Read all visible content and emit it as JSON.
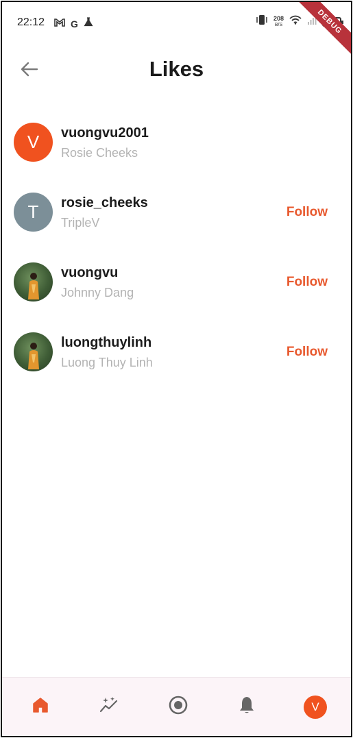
{
  "status_bar": {
    "time": "22:12",
    "left_icons": [
      "gmail-icon",
      "google-icon",
      "flask-icon"
    ],
    "data_rate": "208",
    "data_rate_unit": "B/S",
    "right_icons": [
      "vibrate-icon",
      "wifi-icon",
      "signal-icon",
      "battery-icon"
    ]
  },
  "debug_banner": "DEBUG",
  "header": {
    "back_icon": "arrow-left-icon",
    "title": "Likes"
  },
  "likes": [
    {
      "username": "vuongvu2001",
      "display_name": "Rosie Cheeks",
      "avatar_letter": "V",
      "avatar_color": "#f0521f",
      "avatar_type": "letter",
      "follow_label": ""
    },
    {
      "username": "rosie_cheeks",
      "display_name": "TripleV",
      "avatar_letter": "T",
      "avatar_color": "#7c8f98",
      "avatar_type": "letter",
      "follow_label": "Follow"
    },
    {
      "username": "vuongvu",
      "display_name": "Johnny Dang",
      "avatar_letter": "",
      "avatar_color": "#4a6a3e",
      "avatar_type": "photo",
      "follow_label": "Follow"
    },
    {
      "username": "luongthuylinh",
      "display_name": "Luong Thuy Linh",
      "avatar_letter": "",
      "avatar_color": "#4a6a3e",
      "avatar_type": "photo",
      "follow_label": "Follow"
    }
  ],
  "bottom_nav": {
    "items": [
      "home-icon",
      "sparkle-trend-icon",
      "record-icon",
      "bell-icon",
      "profile-avatar"
    ],
    "active": "home-icon",
    "profile_letter": "V",
    "accent_color": "#e8592e"
  },
  "colors": {
    "accent": "#e8592e",
    "subtitle": "#b3b3b3",
    "nav_background": "#fcf4f8"
  }
}
